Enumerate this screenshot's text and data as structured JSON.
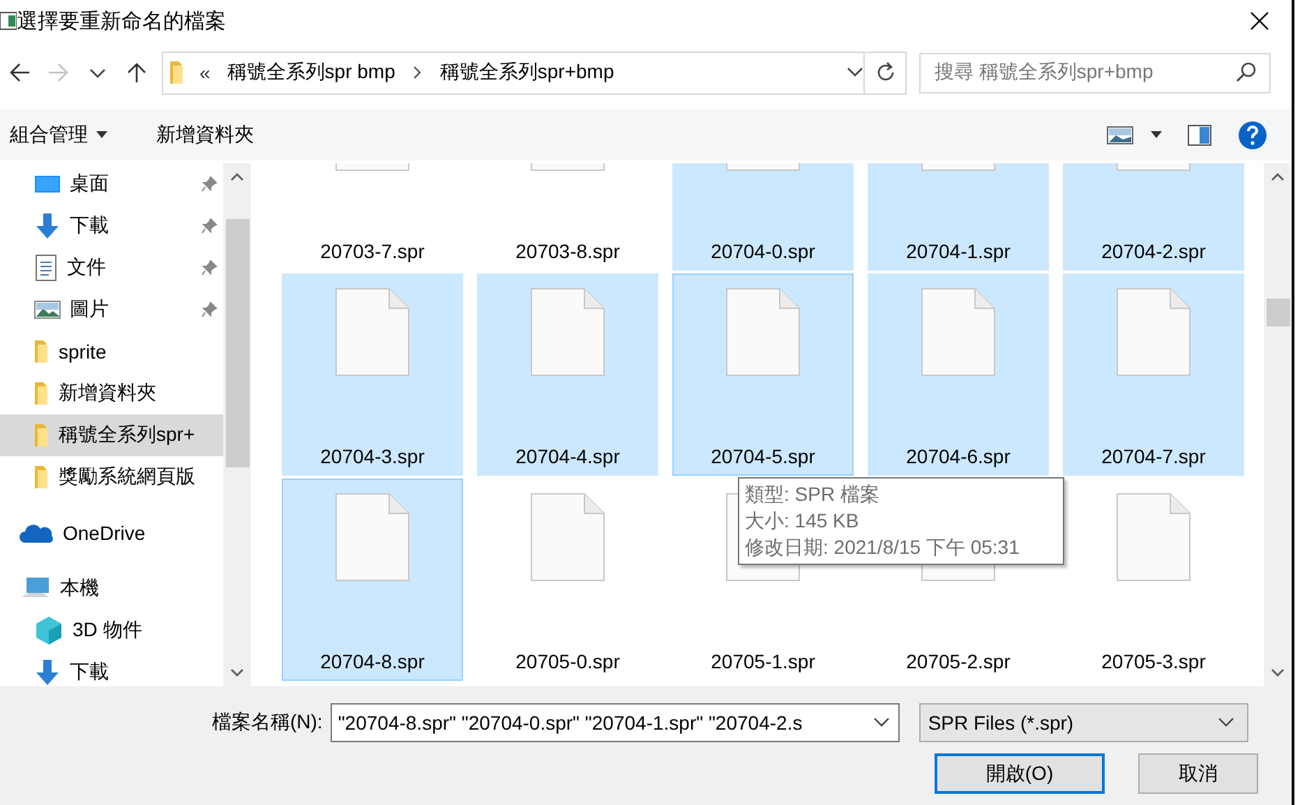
{
  "window": {
    "title": "選擇要重新命名的檔案"
  },
  "nav": {
    "back_disabled": false,
    "forward_disabled": true
  },
  "address": {
    "overflow": "«",
    "crumbs": [
      "稱號全系列spr bmp",
      "稱號全系列spr+bmp"
    ]
  },
  "search": {
    "placeholder": "搜尋 稱號全系列spr+bmp"
  },
  "toolbar": {
    "organize": "組合管理",
    "new_folder": "新增資料夾"
  },
  "sidebar": {
    "quick_access": [
      {
        "label": "桌面",
        "kind": "desktop",
        "pinned": true,
        "selected": false
      },
      {
        "label": "下載",
        "kind": "download",
        "pinned": true,
        "selected": false
      },
      {
        "label": "文件",
        "kind": "document",
        "pinned": true,
        "selected": false
      },
      {
        "label": "圖片",
        "kind": "pictures",
        "pinned": true,
        "selected": false
      },
      {
        "label": "sprite",
        "kind": "folder",
        "pinned": false,
        "selected": false
      },
      {
        "label": "新增資料夾",
        "kind": "folder",
        "pinned": false,
        "selected": false
      },
      {
        "label": "稱號全系列spr+",
        "kind": "folder",
        "pinned": false,
        "selected": true
      },
      {
        "label": "獎勵系統網頁版",
        "kind": "folder",
        "pinned": false,
        "selected": false
      }
    ],
    "tree": [
      {
        "label": "OneDrive",
        "kind": "onedrive",
        "selected": false
      },
      {
        "label": "本機",
        "kind": "pc",
        "selected": false,
        "children": [
          {
            "label": "3D 物件",
            "kind": "cube",
            "selected": false
          },
          {
            "label": "下載",
            "kind": "download",
            "selected": false
          }
        ]
      }
    ]
  },
  "files": [
    {
      "name": "20703-7.spr",
      "selected": false,
      "focused": false
    },
    {
      "name": "20703-8.spr",
      "selected": false,
      "focused": false
    },
    {
      "name": "20704-0.spr",
      "selected": true,
      "focused": false
    },
    {
      "name": "20704-1.spr",
      "selected": true,
      "focused": false
    },
    {
      "name": "20704-2.spr",
      "selected": true,
      "focused": false
    },
    {
      "name": "20704-3.spr",
      "selected": true,
      "focused": false
    },
    {
      "name": "20704-4.spr",
      "selected": true,
      "focused": false
    },
    {
      "name": "20704-5.spr",
      "selected": true,
      "focused": true
    },
    {
      "name": "20704-6.spr",
      "selected": true,
      "focused": false
    },
    {
      "name": "20704-7.spr",
      "selected": true,
      "focused": false
    },
    {
      "name": "20704-8.spr",
      "selected": true,
      "focused": true
    },
    {
      "name": "20705-0.spr",
      "selected": false,
      "focused": false
    },
    {
      "name": "20705-1.spr",
      "selected": false,
      "focused": false
    },
    {
      "name": "20705-2.spr",
      "selected": false,
      "focused": false
    },
    {
      "name": "20705-3.spr",
      "selected": false,
      "focused": false
    }
  ],
  "tooltip": [
    "類型: SPR 檔案",
    "大小: 145 KB",
    "修改日期: 2021/8/15 下午 05:31"
  ],
  "filename": {
    "label": "檔案名稱(N):",
    "value": "\"20704-8.spr\" \"20704-0.spr\" \"20704-1.spr\" \"20704-2.s"
  },
  "filetype": {
    "value": "SPR Files (*.spr)"
  },
  "buttons": [
    {
      "label": "開啟(O)",
      "default": true
    },
    {
      "label": "取消",
      "default": false
    }
  ]
}
